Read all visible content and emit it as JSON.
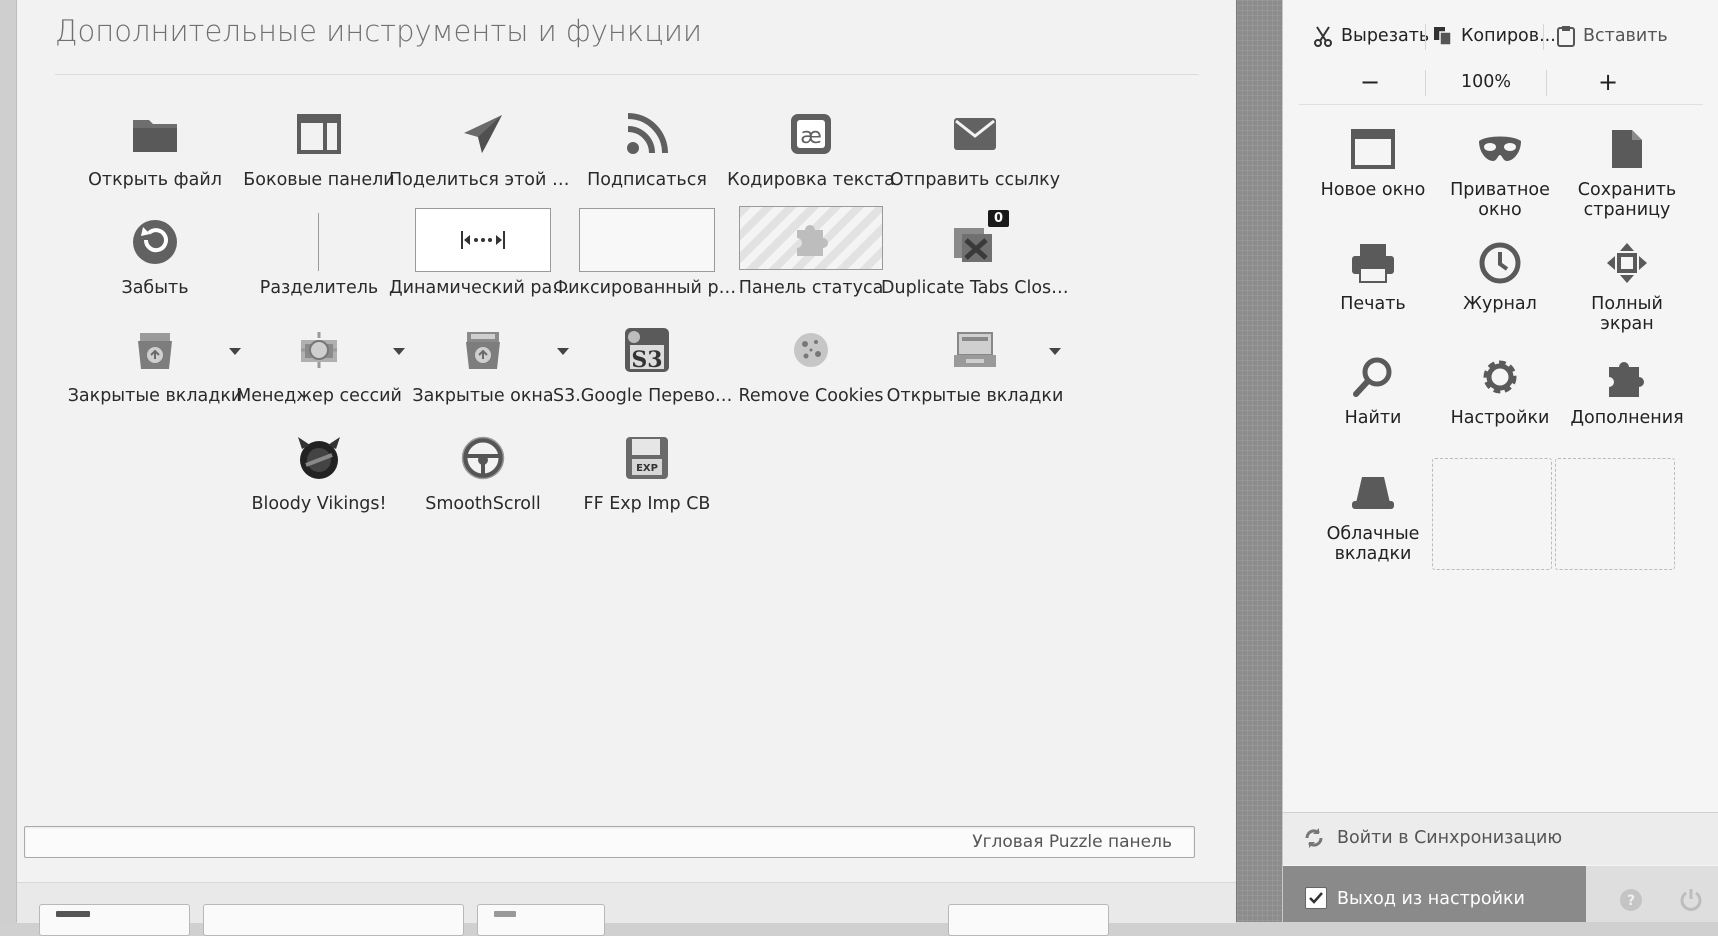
{
  "palette": {
    "title": "Дополнительные инструменты и функции",
    "items": [
      {
        "label": "Открыть файл",
        "icon": "folder-icon"
      },
      {
        "label": "Боковые панели",
        "icon": "sidebar-icon"
      },
      {
        "label": "Поделиться этой ст...",
        "icon": "share-icon"
      },
      {
        "label": "Подписаться",
        "icon": "rss-icon"
      },
      {
        "label": "Кодировка текста",
        "icon": "text-encoding-icon"
      },
      {
        "label": "Отправить ссылку",
        "icon": "email-icon"
      },
      {
        "label": "Забыть",
        "icon": "forget-icon"
      },
      {
        "label": "Разделитель",
        "icon": "separator-icon"
      },
      {
        "label": "Динамический разд...",
        "icon": "flexible-space-icon"
      },
      {
        "label": "Фиксированный ра...",
        "icon": "fixed-space-icon"
      },
      {
        "label": "Панель статуса",
        "icon": "puzzle-icon"
      },
      {
        "label": "Duplicate Tabs Closer",
        "icon": "duplicate-tabs-icon",
        "badge": "0"
      },
      {
        "label": "Закрытые вкладки",
        "icon": "closed-tabs-icon"
      },
      {
        "label": "Менеджер сессий",
        "icon": "session-manager-icon"
      },
      {
        "label": "Закрытые окна",
        "icon": "closed-windows-icon"
      },
      {
        "label": "S3.Google Перевод...",
        "icon": "s3-translate-icon"
      },
      {
        "label": "Remove Cookies",
        "icon": "cookie-icon"
      },
      {
        "label": "Открытые вкладки",
        "icon": "open-tabs-icon"
      },
      {
        "label": "Bloody Vikings!",
        "icon": "vikings-icon"
      },
      {
        "label": "SmoothScroll",
        "icon": "steering-wheel-icon"
      },
      {
        "label": "FF Exp Imp CB",
        "icon": "floppy-exp-icon"
      }
    ]
  },
  "puzzle_bar": {
    "label": "Угловая Puzzle панель"
  },
  "panel": {
    "edit": {
      "cut": "Вырезать",
      "copy": "Копиров...",
      "paste": "Вставить"
    },
    "zoom": {
      "minus": "−",
      "level": "100%",
      "plus": "+"
    },
    "items": [
      {
        "label": "Новое окно",
        "icon": "new-window-icon"
      },
      {
        "label": "Приватное окно",
        "icon": "private-mask-icon"
      },
      {
        "label": "Сохранить страницу",
        "icon": "save-page-icon"
      },
      {
        "label": "Печать",
        "icon": "printer-icon"
      },
      {
        "label": "Журнал",
        "icon": "history-clock-icon"
      },
      {
        "label": "Полный экран",
        "icon": "fullscreen-icon"
      },
      {
        "label": "Найти",
        "icon": "search-icon"
      },
      {
        "label": "Настройки",
        "icon": "gear-icon"
      },
      {
        "label": "Дополнения",
        "icon": "addons-puzzle-icon"
      },
      {
        "label": "Облачные вкладки",
        "icon": "cloud-tabs-icon"
      }
    ],
    "sync_label": "Войти в Синхронизацию",
    "exit_label": "Выход из настройки"
  }
}
